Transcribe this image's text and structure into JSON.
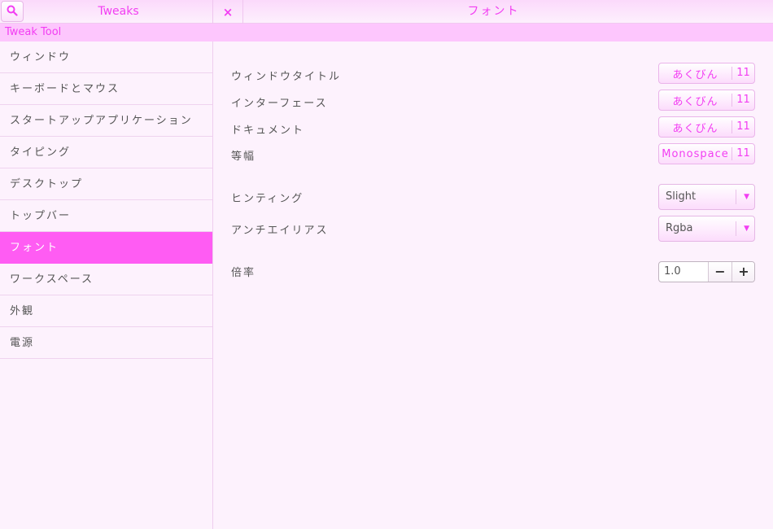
{
  "header": {
    "app_title": "Tweaks",
    "close_label": "×",
    "page_title": "フォント",
    "search_icon": "search-icon",
    "accent_color": "#f23ef2"
  },
  "subbar": {
    "label": "Tweak Tool"
  },
  "sidebar": {
    "items": [
      {
        "label": "ウィンドウ"
      },
      {
        "label": "キーボードとマウス"
      },
      {
        "label": "スタートアップアプリケーション"
      },
      {
        "label": "タイピング"
      },
      {
        "label": "デスクトップ"
      },
      {
        "label": "トップバー"
      },
      {
        "label": "フォント",
        "active": true
      },
      {
        "label": "ワークスペース"
      },
      {
        "label": "外観"
      },
      {
        "label": "電源"
      }
    ],
    "active_color": "#ff5cf3"
  },
  "fonts": {
    "window_title": {
      "label": "ウィンドウタイトル",
      "font": "あくびん",
      "size": "11"
    },
    "interface": {
      "label": "インターフェース",
      "font": "あくびん",
      "size": "11"
    },
    "document": {
      "label": "ドキュメント",
      "font": "あくびん",
      "size": "11"
    },
    "monospace": {
      "label": "等幅",
      "font": "Monospace",
      "size": "11"
    }
  },
  "hinting": {
    "label": "ヒンティング",
    "value": "Slight"
  },
  "antialiasing": {
    "label": "アンチエイリアス",
    "value": "Rgba"
  },
  "scaling": {
    "label": "倍率",
    "value": "1.0",
    "minus": "−",
    "plus": "+"
  }
}
